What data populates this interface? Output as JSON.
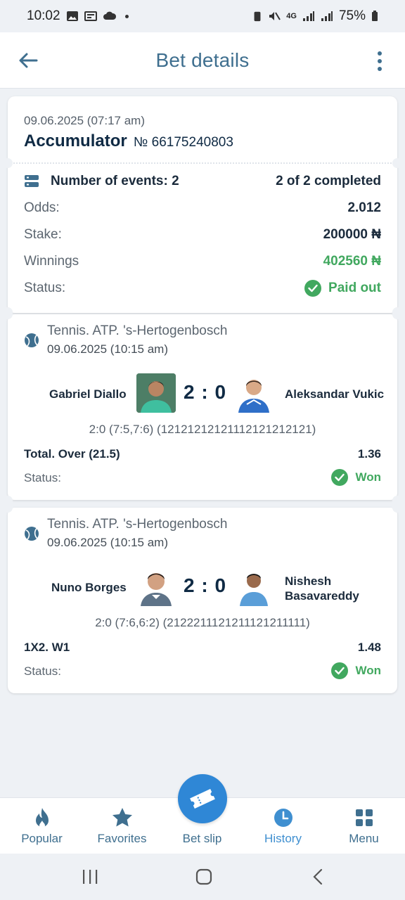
{
  "status_bar": {
    "time": "10:02",
    "battery": "75%",
    "network": "4G"
  },
  "header": {
    "title": "Bet details"
  },
  "summary": {
    "date": "09.06.2025 (07:17 am)",
    "bet_type": "Accumulator",
    "bet_number": "№ 66175240803",
    "events_label": "Number of events: 2",
    "completed": "2 of 2 completed",
    "odds_label": "Odds:",
    "odds_value": "2.012",
    "stake_label": "Stake:",
    "stake_value": "200000 ₦",
    "winnings_label": "Winnings",
    "winnings_value": "402560 ₦",
    "status_label": "Status:",
    "status_value": "Paid out"
  },
  "events": [
    {
      "sport": "Tennis. ATP. 's-Hertogenbosch",
      "date": "09.06.2025 (10:15 am)",
      "team1": "Gabriel Diallo",
      "team2": "Aleksandar Vukic",
      "score": "2 : 0",
      "sets": "2:0 (7:5,7:6) (12121212121112121212121)",
      "market": "Total. Over (21.5)",
      "coef": "1.36",
      "status_label": "Status:",
      "status_value": "Won"
    },
    {
      "sport": "Tennis. ATP. 's-Hertogenbosch",
      "date": "09.06.2025 (10:15 am)",
      "team1": "Nuno Borges",
      "team2_line1": "Nishesh",
      "team2_line2": "Basavareddy",
      "score": "2 : 0",
      "sets": "2:0 (7:6,6:2) (2122211121211121211111)",
      "market": "1X2. W1",
      "coef": "1.48",
      "status_label": "Status:",
      "status_value": "Won"
    }
  ],
  "bottom_nav": {
    "popular": "Popular",
    "favorites": "Favorites",
    "bet_slip": "Bet slip",
    "history": "History",
    "menu": "Menu"
  },
  "colors": {
    "accent": "#3f6f8f",
    "active": "#3f8fd0",
    "green": "#41a85f",
    "fab": "#2f87d6"
  }
}
